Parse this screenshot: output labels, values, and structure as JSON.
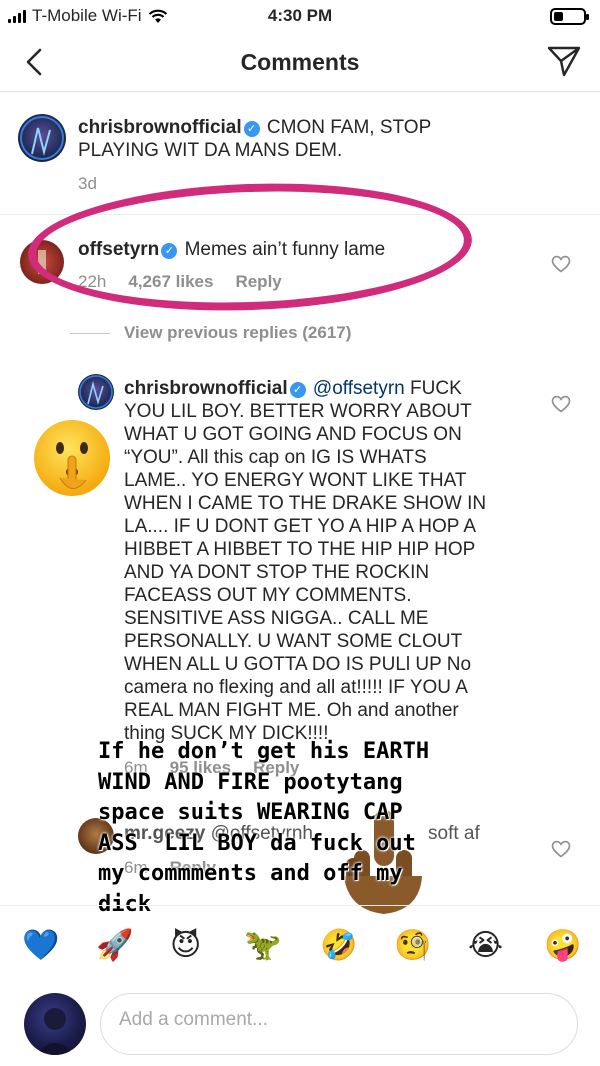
{
  "status_bar": {
    "carrier": "T-Mobile Wi-Fi",
    "time": "4:30 PM"
  },
  "header": {
    "title": "Comments"
  },
  "caption": {
    "username": "chrisbrownofficial",
    "text": "CMON FAM, STOP PLAYING WIT DA MANS DEM.",
    "time": "3d"
  },
  "comments": [
    {
      "username": "offsetyrn",
      "text": "Memes ain’t funny lame",
      "time": "22h",
      "likes": "4,267 likes",
      "reply_label": "Reply"
    }
  ],
  "view_previous": "View previous replies (2617)",
  "replies": [
    {
      "username": "chrisbrownofficial",
      "mention": "@offsetyrn",
      "lines": [
        "FUCK",
        "YOU LIL BOY. BETTER WORRY ABOUT",
        "WHAT U GOT GOING AND FOCUS ON",
        "“YOU”. All this cap on IG IS WHATS",
        "LAME.. YO ENERGY WONT LIKE THAT",
        "WHEN I CAME TO THE DRAKE SHOW IN",
        "LA.... IF U DONT  GET YO A HIP A HOP A",
        "HIBBET A HIBBET TO THE HIP HIP HOP",
        "AND YA DONT STOP THE ROCKIN",
        "FACEASS OUT MY COMMENTS.",
        "SENSITIVE ASS NIGGA.. CALL ME",
        "PERSONALLY. U WANT SOME CLOUT",
        "WHEN ALL U GOTTA DO IS PULl UP No",
        "camera no flexing and all at!!!!! IF YOU A",
        "REAL MAN FIGHT ME. Oh and another",
        "thing  SUCK MY DICK!!!!"
      ],
      "time": "6m",
      "likes": "95 likes",
      "reply_label": "Reply"
    },
    {
      "username": "mr.geezy",
      "mention": "@offsetyrn",
      "text": "h",
      "text_tail": "soft af",
      "time": "6m",
      "reply_label": "Reply"
    }
  ],
  "overlay_text": "If he don’t get his EARTH\nWIND AND FIRE pootytang\nspace suits WEARING CAP\nASS  LIL BOY da fuck out\nmy commments and off my\ndick",
  "emoji_bar": [
    "💙",
    "🚀",
    "😈",
    "🦖",
    "🤣",
    "🧐",
    "😭",
    "🤪"
  ],
  "composer": {
    "placeholder": "Add a comment..."
  }
}
